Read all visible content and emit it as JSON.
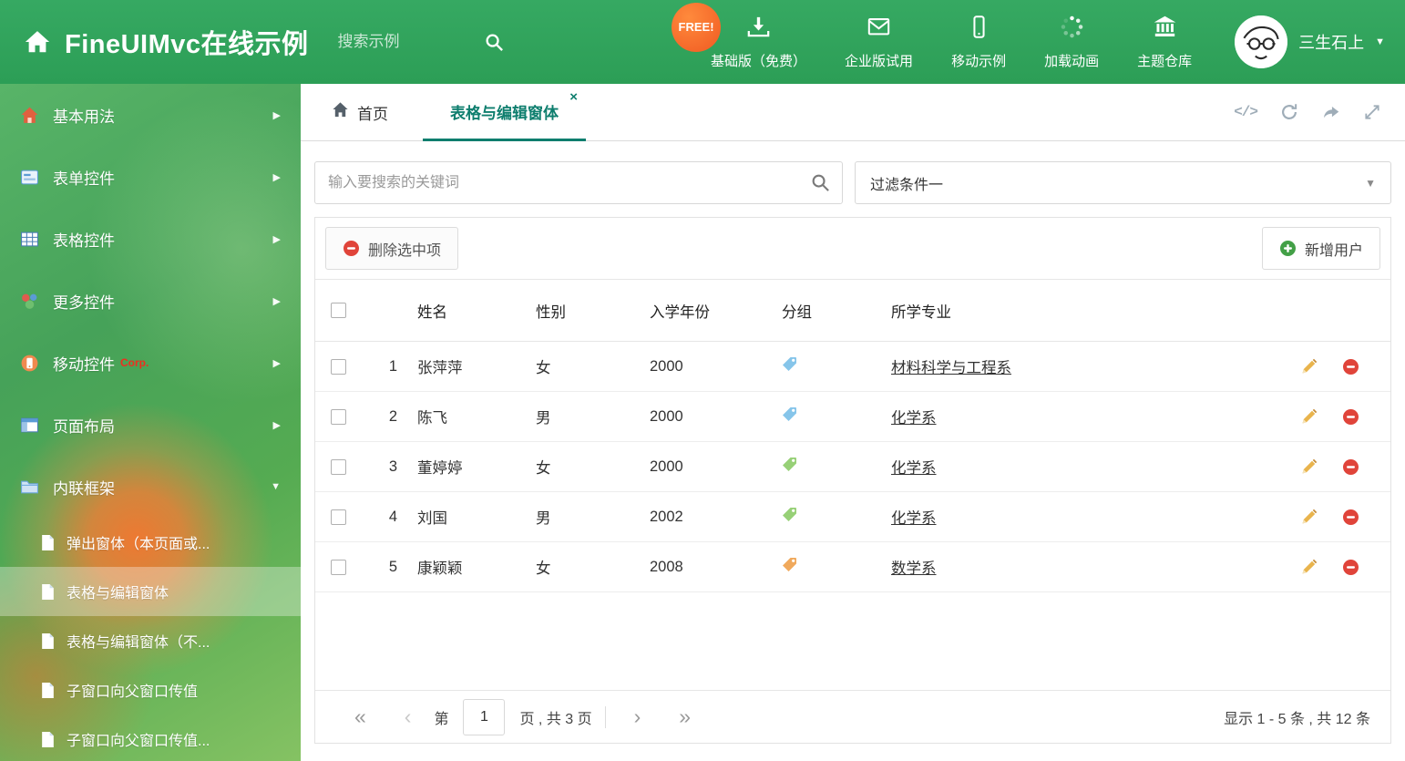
{
  "header": {
    "title": "FineUIMvc在线示例",
    "search_placeholder": "搜索示例",
    "free_badge": "FREE!",
    "nav": [
      {
        "label": "基础版（免费）",
        "icon": "download-icon"
      },
      {
        "label": "企业版试用",
        "icon": "mail-icon"
      },
      {
        "label": "移动示例",
        "icon": "mobile-icon"
      },
      {
        "label": "加载动画",
        "icon": "spinner-icon"
      },
      {
        "label": "主题仓库",
        "icon": "bank-icon"
      }
    ],
    "user_name": "三生石上"
  },
  "sidebar": {
    "items": [
      {
        "label": "基本用法",
        "icon": "house-icon"
      },
      {
        "label": "表单控件",
        "icon": "form-icon"
      },
      {
        "label": "表格控件",
        "icon": "table-icon"
      },
      {
        "label": "更多控件",
        "icon": "shapes-icon"
      },
      {
        "label": "移动控件",
        "badge": "Corp.",
        "icon": "mobile-icon"
      },
      {
        "label": "页面布局",
        "icon": "layout-icon"
      },
      {
        "label": "内联框架",
        "icon": "folder-icon",
        "expanded": true
      }
    ],
    "subitems": [
      {
        "label": "弹出窗体（本页面或..."
      },
      {
        "label": "表格与编辑窗体",
        "selected": true
      },
      {
        "label": "表格与编辑窗体（不..."
      },
      {
        "label": "子窗口向父窗口传值"
      },
      {
        "label": "子窗口向父窗口传值..."
      }
    ]
  },
  "tabbar": {
    "home_tab": "首页",
    "active_tab": "表格与编辑窗体"
  },
  "filter": {
    "search_placeholder": "输入要搜索的关键词",
    "dropdown_value": "过滤条件一"
  },
  "toolbar": {
    "delete_button": "删除选中项",
    "add_button": "新增用户"
  },
  "table": {
    "headers": {
      "name": "姓名",
      "gender": "性别",
      "year": "入学年份",
      "group": "分组",
      "major": "所学专业"
    },
    "rows": [
      {
        "num": "1",
        "name": "张萍萍",
        "gender": "女",
        "year": "2000",
        "tag_color": "#86c5ea",
        "major": "材料科学与工程系"
      },
      {
        "num": "2",
        "name": "陈飞",
        "gender": "男",
        "year": "2000",
        "tag_color": "#86c5ea",
        "major": "化学系"
      },
      {
        "num": "3",
        "name": "董婷婷",
        "gender": "女",
        "year": "2000",
        "tag_color": "#97d077",
        "major": "化学系"
      },
      {
        "num": "4",
        "name": "刘国",
        "gender": "男",
        "year": "2002",
        "tag_color": "#97d077",
        "major": "化学系"
      },
      {
        "num": "5",
        "name": "康颖颖",
        "gender": "女",
        "year": "2008",
        "tag_color": "#f0a95c",
        "major": "数学系"
      }
    ]
  },
  "pagination": {
    "page_label_prefix": "第",
    "page_value": "1",
    "page_label_suffix": "页 , 共 3 页",
    "summary": "显示 1 - 5 条 , 共 12 条"
  },
  "icons": {
    "chevron_right": "▶",
    "chevron_down": "▼",
    "close": "×",
    "code": "</>",
    "first_page": "«",
    "prev_page": "‹",
    "next_page": "›",
    "last_page": "»"
  },
  "colors": {
    "header_green": "#2fa35d",
    "active_tab_teal": "#0e7e6e",
    "free_badge_orange": "#f05a22",
    "corp_badge_red": "#ee2f1f"
  }
}
